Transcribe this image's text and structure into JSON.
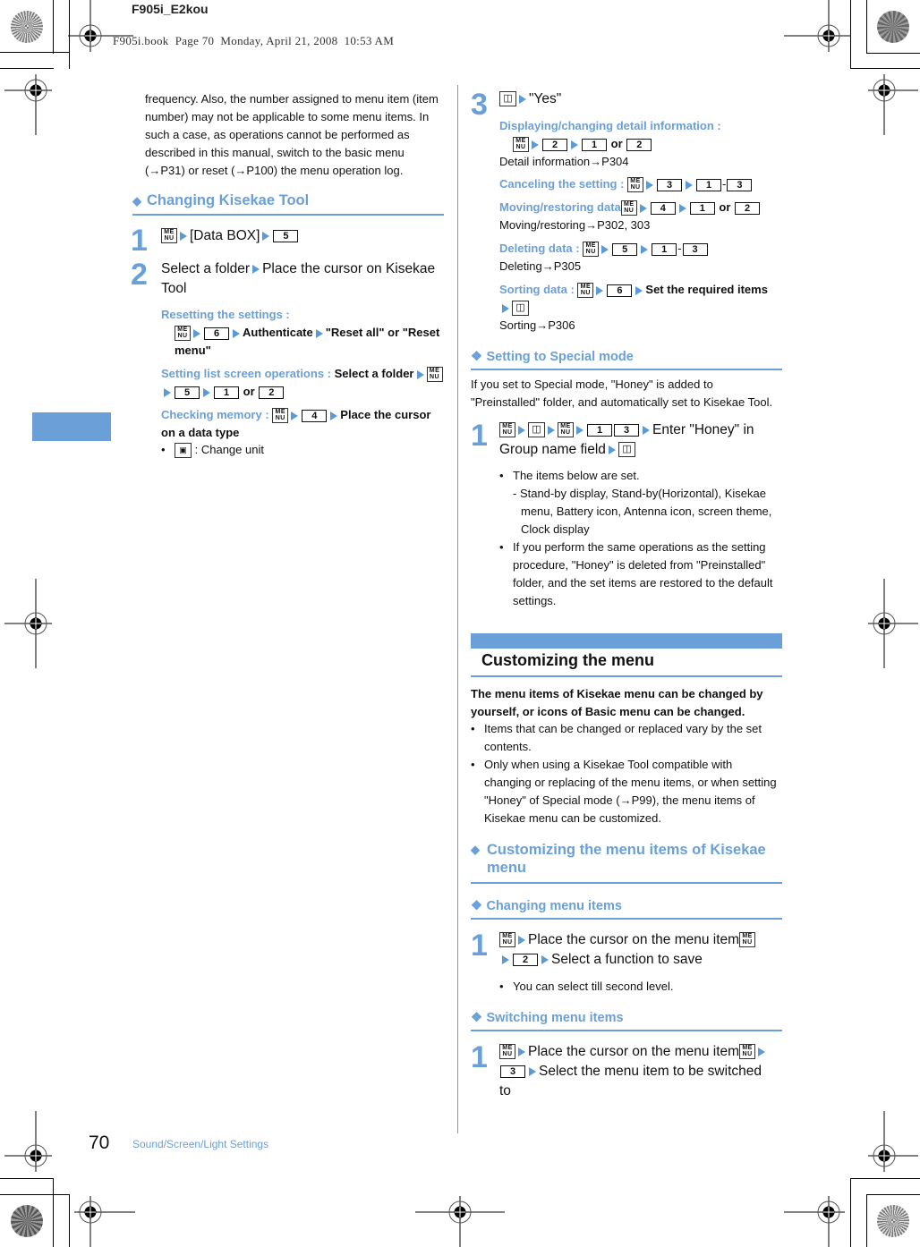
{
  "header": {
    "file_label": "F905i_E2kou",
    "book_stamp": "F905i.book  Page 70  Monday, April 21, 2008  10:53 AM"
  },
  "footer": {
    "page_number": "70",
    "section_title": "Sound/Screen/Light Settings"
  },
  "left": {
    "intro": "frequency. Also, the number assigned to menu item (item number) may not be applicable to some menu items. In such a case, as operations cannot be performed as described in this manual, switch to the basic menu (→P31) or reset (→P100) the menu operation log.",
    "section_heading": "Changing Kisekae Tool",
    "step1": {
      "num": "1",
      "text": "[Data BOX]",
      "key": "5"
    },
    "step2": {
      "num": "2",
      "text_a": "Select a folder",
      "text_b": "Place the cursor on Kisekae Tool"
    },
    "resetting": {
      "label": "Resetting the settings :",
      "key": "6",
      "t1": "Authenticate",
      "t2": "\"Reset all\" or \"Reset menu\""
    },
    "setting_list": {
      "label": "Setting list screen operations :",
      "t1": "Select a folder",
      "key1": "5",
      "key2": "1",
      "or": "or",
      "key3": "2"
    },
    "checking": {
      "label": "Checking memory :",
      "key": "4",
      "t1": "Place the cursor on a data type"
    },
    "change_unit": ": Change unit"
  },
  "right": {
    "step3": {
      "num": "3",
      "text": "\"Yes\""
    },
    "displaying": {
      "label": "Displaying/changing detail information :",
      "key1": "2",
      "key2": "1",
      "or": "or",
      "key3": "2",
      "ref": "Detail information→P304"
    },
    "canceling": {
      "label": "Canceling the setting :",
      "key1": "3",
      "key2": "1",
      "key3": "3"
    },
    "moving": {
      "label": "Moving/restoring data",
      "key1": "4",
      "key2": "1",
      "or": "or",
      "key3": "2",
      "ref": "Moving/restoring→P302, 303"
    },
    "deleting": {
      "label": "Deleting data :",
      "key1": "5",
      "key2": "1",
      "key3": "3",
      "ref": "Deleting→P305"
    },
    "sorting": {
      "label": "Sorting data :",
      "key1": "6",
      "t1": "Set the required items",
      "ref": "Sorting→P306"
    },
    "special_heading": "Setting to Special mode",
    "special_intro": "If you set to Special mode, \"Honey\" is added to \"Preinstalled\" folder, and automatically set to Kisekae Tool.",
    "special_step": {
      "num": "1",
      "key1": "1",
      "key2": "3",
      "t1": "Enter \"Honey\" in Group name field"
    },
    "special_bullets": [
      "The items below are set.",
      "If you perform the same operations as the setting procedure, \"Honey\" is deleted from \"Preinstalled\" folder, and the set items are restored to the default settings."
    ],
    "special_sub": "- Stand-by display, Stand-by(Horizontal), Kisekae menu, Battery icon, Antenna icon, screen theme, Clock display",
    "custom_title": "Customizing the menu",
    "custom_intro": "The menu items of Kisekae menu can be changed by yourself, or icons of Basic menu can be changed.",
    "custom_bullets": [
      "Items that can be changed or replaced vary by the set contents.",
      "Only when using a Kisekae Tool compatible with changing or replacing of the menu items, or when setting \"Honey\" of Special mode (→P99), the menu items of Kisekae menu can be customized."
    ],
    "custom_items_heading": "Customizing the menu items of Kisekae menu",
    "changing_heading": "Changing menu items",
    "changing_step": {
      "num": "1",
      "t1": "Place the cursor on the menu item",
      "key": "2",
      "t2": "Select a function to save"
    },
    "changing_bullet": "You can select till second level.",
    "switching_heading": "Switching menu items",
    "switching_step": {
      "num": "1",
      "t1": "Place the cursor on the menu item",
      "key": "3",
      "t2": "Select the menu item to be switched to"
    }
  },
  "icons": {
    "menu_key": "ME NU",
    "book_key": "◫",
    "diamond": "◆",
    "fourdiamond": "❖"
  },
  "colors": {
    "accent": "#6a9fd8"
  }
}
